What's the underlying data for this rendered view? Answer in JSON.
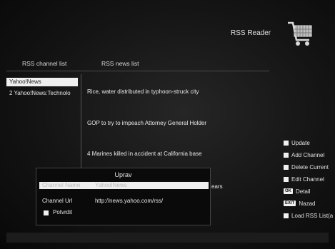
{
  "header": {
    "title": "RSS Reader",
    "icon": "shopping-cart-icon"
  },
  "columns": {
    "channels_label": "RSS channel list",
    "news_label": "RSS news list"
  },
  "channels": [
    {
      "label": "Yahoo!News"
    },
    {
      "label": "2  Yahoo!News:Technolo"
    }
  ],
  "news": [
    "Rice, water distributed in typhoon-struck city",
    "GOP to try to impeach Attorney General Holder",
    "4 Marines killed in accident at California base"
  ],
  "news_overflow": "ears",
  "legend": [
    {
      "type": "square",
      "label": "Update"
    },
    {
      "type": "square",
      "label": "Add Channel"
    },
    {
      "type": "square",
      "label": "Delete Current"
    },
    {
      "type": "square",
      "label": "Edit Channel"
    },
    {
      "type": "key",
      "key": "OK",
      "label": "Detail"
    },
    {
      "type": "key",
      "key": "EXIT",
      "label": "Nazad"
    },
    {
      "type": "square",
      "label": "Load RSS List(a"
    }
  ],
  "dialog": {
    "title": "Uprav",
    "channel_name_label": "Channel Name",
    "channel_name_value": "Yahoo!News",
    "channel_url_label": "Channel Url",
    "channel_url_value": "http://news.yahoo.com/rss/",
    "confirm_label": "Potvrdit"
  }
}
